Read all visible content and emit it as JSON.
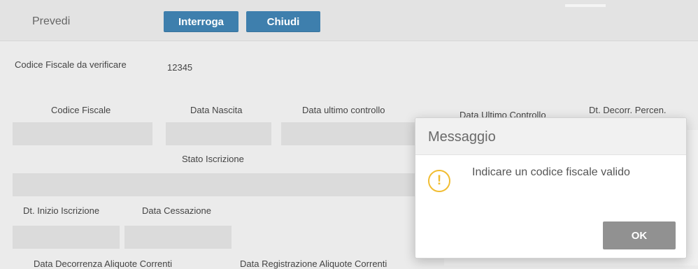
{
  "toolbar": {
    "title": "Prevedi",
    "buttons": {
      "interroga": "Interroga",
      "chiudi": "Chiudi"
    }
  },
  "form": {
    "codice_fiscale_label": "Codice Fiscale da verificare",
    "codice_fiscale_value": "12345",
    "columns": {
      "codice_fiscale": "Codice Fiscale",
      "data_nascita": "Data Nascita",
      "data_ultimo_controllo": "Data ultimo controllo",
      "data_ultimo_controllo_2": "Data Ultimo Controllo",
      "dt_decorr_percen": "Dt. Decorr. Percen."
    },
    "stato_iscrizione": "Stato Iscrizione",
    "dt_inizio_iscrizione": "Dt. Inizio Iscrizione",
    "data_cessazione": "Data Cessazione",
    "data_decorrenza_aliquote": "Data Decorrenza Aliquote Correnti",
    "data_registrazione_aliquote": "Data Registrazione Aliquote Correnti"
  },
  "modal": {
    "title": "Messaggio",
    "icon": "warning-icon",
    "message": "Indicare un codice fiscale valido",
    "ok_label": "OK",
    "icon_color": "#f1bd32"
  }
}
